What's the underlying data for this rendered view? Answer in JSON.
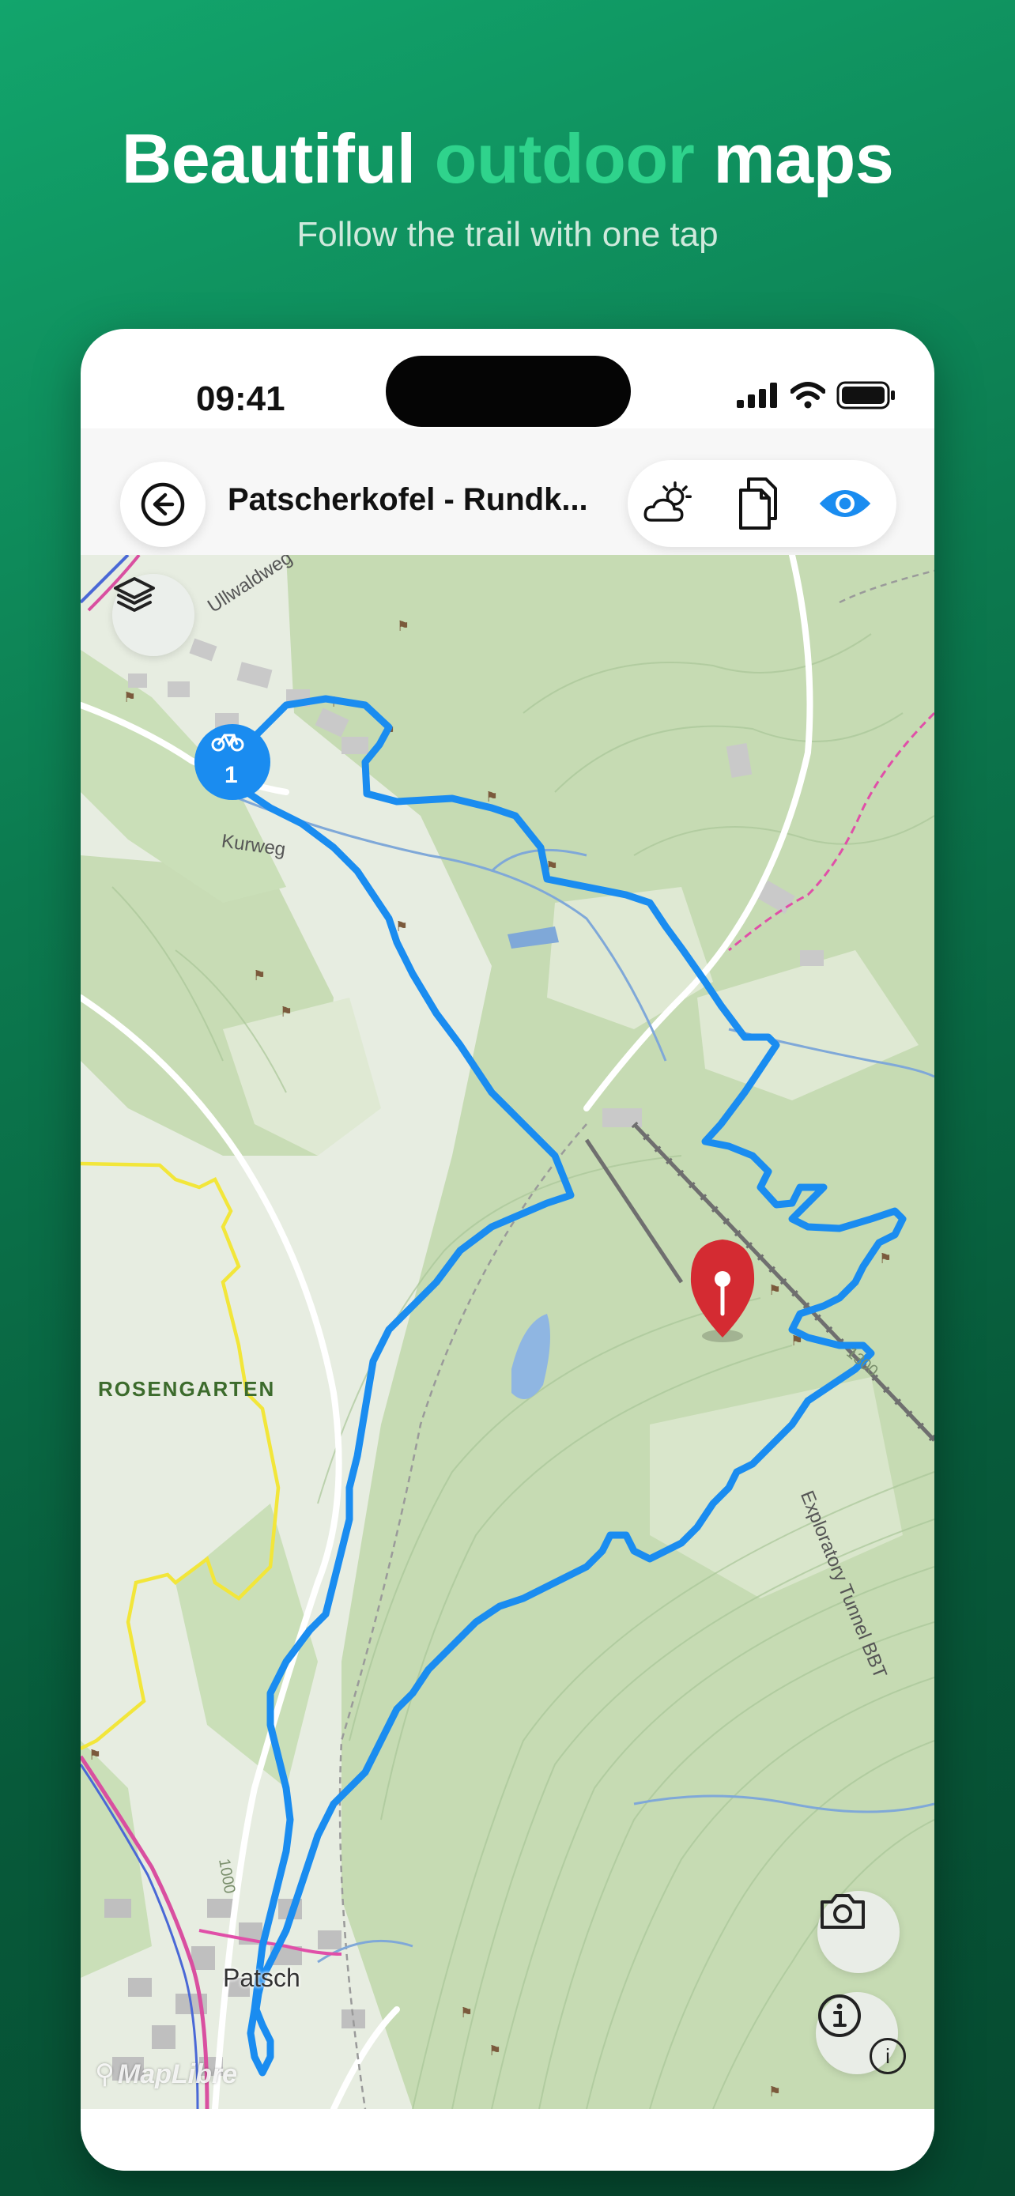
{
  "headline": {
    "part1": "Beautiful",
    "accent": "outdoor",
    "part2": "maps",
    "subtitle": "Follow the trail with one tap"
  },
  "status_bar": {
    "time": "09:41"
  },
  "app_bar": {
    "route_title": "Patscherkofel - Rundk..."
  },
  "map": {
    "labels": {
      "street_1": "Ullwaldweg",
      "street_2": "Kurweg",
      "area": "ROSENGARTEN",
      "village": "Patsch",
      "tunnel": "Exploratory Tunnel BBT",
      "contour_1": "1300",
      "contour_2": "1000",
      "attribution": "MapLibre"
    },
    "start_marker_number": "1"
  },
  "icons": [
    "back-arrow-icon",
    "weather-icon",
    "copy-icon",
    "eye-icon",
    "layers-icon",
    "bike-icon",
    "location-pin-icon",
    "camera-icon",
    "info-icon"
  ],
  "colors": {
    "accent": "#2fd38c",
    "route": "#1a8cf0",
    "pin": "#d42b32",
    "map_green": "#c9ddb6"
  }
}
